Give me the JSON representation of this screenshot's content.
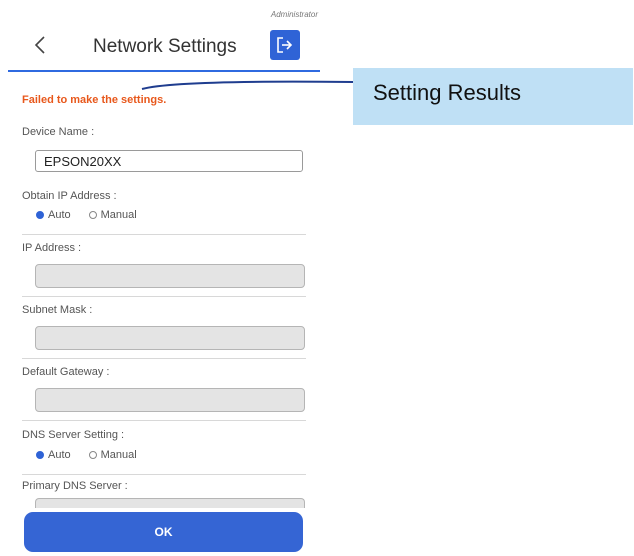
{
  "header": {
    "role_label": "Administrator",
    "title": "Network Settings"
  },
  "error_message": "Failed to make the settings.",
  "form": {
    "device_name": {
      "label": "Device Name :",
      "value": "EPSON20XX"
    },
    "obtain_ip": {
      "label": "Obtain IP Address :",
      "options": [
        "Auto",
        "Manual"
      ],
      "selected": "Auto"
    },
    "ip_address": {
      "label": "IP Address :"
    },
    "subnet_mask": {
      "label": "Subnet Mask :"
    },
    "default_gateway": {
      "label": "Default Gateway :"
    },
    "dns_server_setting": {
      "label": "DNS Server Setting :",
      "options": [
        "Auto",
        "Manual"
      ],
      "selected": "Auto"
    },
    "primary_dns": {
      "label": "Primary DNS Server :"
    }
  },
  "ok_label": "OK",
  "callout": {
    "text": "Setting Results"
  },
  "colors": {
    "accent": "#2f63d6",
    "error": "#e8581c",
    "callout_bg": "#bfe0f5"
  },
  "icons": {
    "back": "chevron-left-icon",
    "logout": "logout-icon"
  }
}
